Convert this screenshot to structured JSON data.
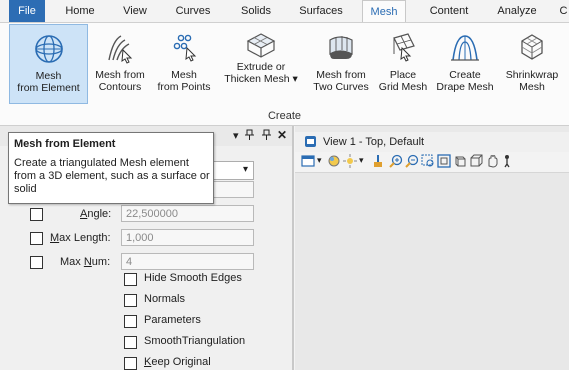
{
  "ribbon": {
    "tabs": [
      "File",
      "Home",
      "View",
      "Curves",
      "Solids",
      "Surfaces",
      "Mesh",
      "Content",
      "Analyze",
      "C"
    ],
    "active_tab": "Mesh",
    "group_label": "Create",
    "buttons": [
      {
        "line1": "Mesh",
        "line2": "from Element",
        "icon": "mesh-from-element-icon"
      },
      {
        "line1": "Mesh from",
        "line2": "Contours",
        "icon": "mesh-from-contours-icon"
      },
      {
        "line1": "Mesh",
        "line2": "from Points",
        "icon": "mesh-from-points-icon"
      },
      {
        "line1": "Extrude or",
        "line2": "Thicken Mesh ▾",
        "icon": "extrude-mesh-icon"
      },
      {
        "line1": "Mesh from",
        "line2": "Two Curves",
        "icon": "mesh-two-curves-icon"
      },
      {
        "line1": "Place",
        "line2": "Grid Mesh",
        "icon": "grid-mesh-icon"
      },
      {
        "line1": "Create",
        "line2": "Drape Mesh",
        "icon": "drape-mesh-icon"
      },
      {
        "line1": "Shrinkwrap",
        "line2": "Mesh",
        "icon": "shrinkwrap-mesh-icon"
      }
    ]
  },
  "tooltip": {
    "title": "Mesh from Element",
    "description": "Create a triangulated Mesh element from a 3D element, such as a surface or solid"
  },
  "dialog": {
    "angle": {
      "prefix": "",
      "ul": "A",
      "rest": "ngle:",
      "value": "22,500000"
    },
    "max_length": {
      "prefix": "",
      "ul": "M",
      "rest": "ax Length:",
      "value": "1,000"
    },
    "max_num": {
      "prefix": "Max ",
      "ul": "N",
      "rest": "um:",
      "value": "4"
    },
    "options": [
      {
        "label": "Hide Smooth Edges",
        "ul": ""
      },
      {
        "label": "Normals",
        "ul": ""
      },
      {
        "label": "Parameters",
        "ul": ""
      },
      {
        "label": "SmoothTriangulation",
        "ul": ""
      },
      {
        "label": "eep Original",
        "ul": "K"
      }
    ]
  },
  "view": {
    "title": "View 1 - Top, Default"
  },
  "colors": {
    "file_tab": "#2d6db4",
    "active_tab_text": "#2a6cb3",
    "selected_button": "#cde3f7",
    "icon_blue": "#2a6cb3"
  }
}
